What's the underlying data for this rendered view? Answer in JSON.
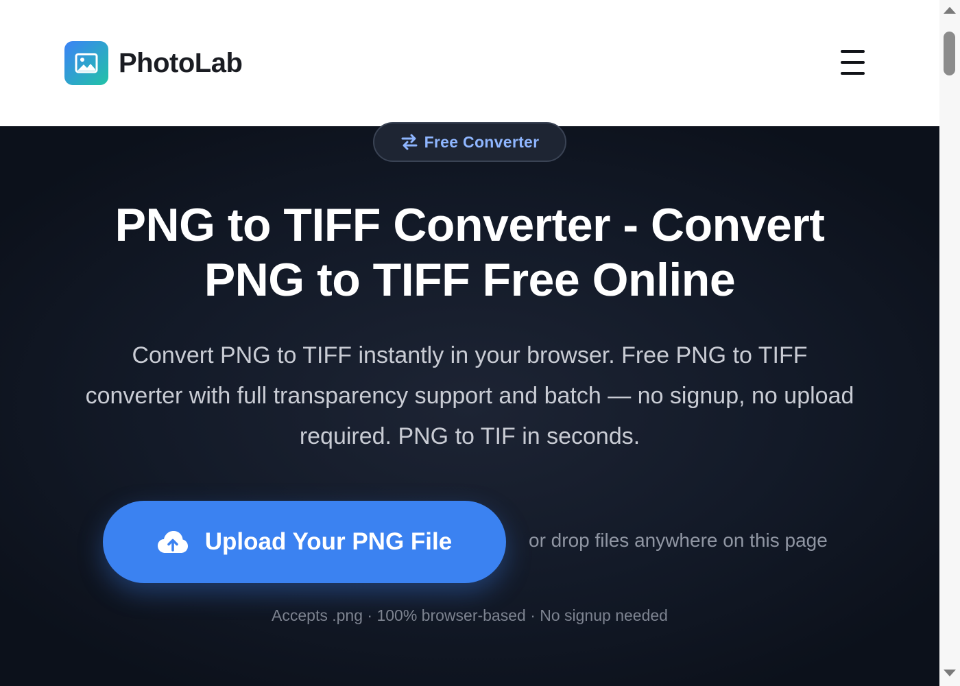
{
  "brand": {
    "name": "PhotoLab",
    "logo_icon": "image-icon",
    "gradient": [
      "#3b82f6",
      "#22c3a6"
    ]
  },
  "header": {
    "menu_icon": "hamburger-menu-icon"
  },
  "hero": {
    "badge": {
      "icon": "swap-arrows-icon",
      "label": "Free Converter"
    },
    "title_line1": "PNG to TIFF Converter - Convert",
    "title_line2": "PNG to TIFF Free Online",
    "subtitle": "Convert PNG to TIFF instantly in your browser. Free PNG to TIFF converter with full transparency support and batch — no signup, no upload required. PNG to TIF in seconds.",
    "upload_button": {
      "icon": "cloud-upload-icon",
      "label": "Upload Your PNG File"
    },
    "drop_hint": "or drop files anywhere on this page",
    "accepts": "Accepts .png · 100% browser-based · No signup needed"
  },
  "colors": {
    "accent": "#3b82f1",
    "hero_background": "#131a28",
    "badge_text": "#8fb6ff"
  }
}
